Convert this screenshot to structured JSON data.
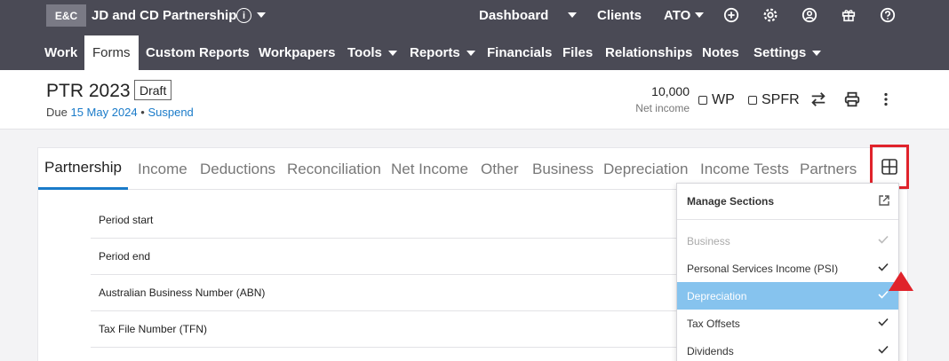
{
  "topbar": {
    "logo": "E&C",
    "client_name": "JD and CD Partnership",
    "info_glyph": "i",
    "dashboard": "Dashboard",
    "clients": "Clients",
    "ato": "ATO",
    "icons": [
      "plus-circle-icon",
      "gear-icon",
      "user-icon",
      "gift-icon",
      "help-icon"
    ]
  },
  "nav": {
    "items": [
      {
        "label": "Work"
      },
      {
        "label": "Forms",
        "active": true
      },
      {
        "label": "Custom Reports"
      },
      {
        "label": "Workpapers"
      },
      {
        "label": "Tools",
        "dropdown": true
      },
      {
        "label": "Reports",
        "dropdown": true
      },
      {
        "label": "Financials"
      },
      {
        "label": "Files"
      },
      {
        "label": "Relationships"
      },
      {
        "label": "Notes"
      },
      {
        "label": "Settings",
        "dropdown": true
      }
    ]
  },
  "header": {
    "title": "PTR 2023",
    "status": "Draft",
    "due_prefix": "Due",
    "due_date": "15 May 2024",
    "separator": "•",
    "suspend": "Suspend",
    "net_income_value": "10,000",
    "net_income_label": "Net income",
    "wp_label": "WP",
    "spfr_label": "SPFR"
  },
  "tabs": [
    {
      "label": "Partnership",
      "active": true
    },
    {
      "label": "Income"
    },
    {
      "label": "Deductions"
    },
    {
      "label": "Reconciliation"
    },
    {
      "label": "Net Income"
    },
    {
      "label": "Other"
    },
    {
      "label": "Business"
    },
    {
      "label": "Depreciation"
    },
    {
      "label": "Income Tests"
    },
    {
      "label": "Partners"
    }
  ],
  "fields": [
    {
      "label": "Period start"
    },
    {
      "label": "Period end"
    },
    {
      "label": "Australian Business Number (ABN)"
    },
    {
      "label": "Tax File Number (TFN)"
    }
  ],
  "dropdown": {
    "title": "Manage Sections",
    "items": [
      {
        "label": "Business",
        "state": "disabled",
        "checked": true
      },
      {
        "label": "Personal Services Income (PSI)",
        "checked": true
      },
      {
        "label": "Depreciation",
        "state": "selected",
        "checked": true
      },
      {
        "label": "Tax Offsets",
        "checked": true
      },
      {
        "label": "Dividends",
        "checked": true
      }
    ]
  },
  "colors": {
    "topbar": "#4a4a55",
    "accent": "#1a7bc9",
    "highlight": "#e0232b",
    "selected": "#86c3ee"
  }
}
